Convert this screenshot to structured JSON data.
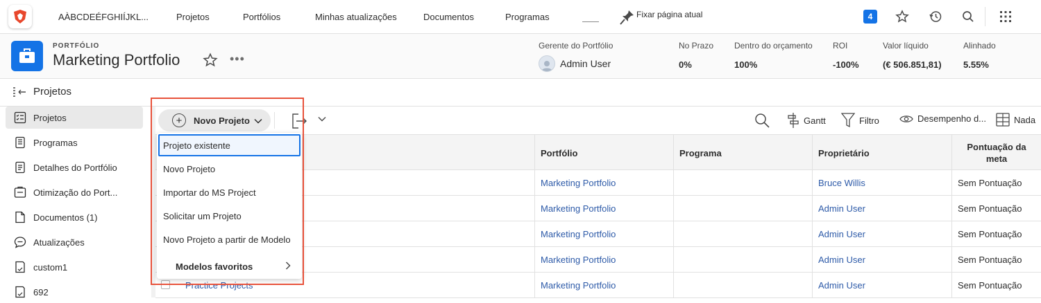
{
  "topnav": {
    "items": [
      "AÀBCDEÉFGHIÍJKL...",
      "Projetos",
      "Portfólios",
      "Minhas atualizações",
      "Documentos",
      "Programas"
    ],
    "pin_label": "Fixar página atual",
    "badge_count": "4",
    "icons": [
      "star-icon",
      "history-icon",
      "search-icon",
      "apps-grid-icon"
    ]
  },
  "portfolio": {
    "kicker": "PORTFÓLIO",
    "title": "Marketing Portfolio",
    "more": "•••",
    "manager_label": "Gerente do Portfólio",
    "manager_name": "Admin User",
    "metrics": [
      {
        "label": "No Prazo",
        "value": "0%"
      },
      {
        "label": "Dentro do orçamento",
        "value": "100%"
      },
      {
        "label": "ROI",
        "value": "-100%"
      },
      {
        "label": "Valor líquido",
        "value": "(€ 506.851,81)"
      },
      {
        "label": "Alinhado",
        "value": "5.55%"
      }
    ]
  },
  "left_panel": {
    "heading": "Projetos",
    "items": [
      "Projetos",
      "Programas",
      "Detalhes do Portfólio",
      "Otimização do Port...",
      "Documentos (1)",
      "Atualizações",
      "custom1",
      "692"
    ]
  },
  "toolbar": {
    "new_project": "Novo Projeto",
    "gantt": "Gantt",
    "filter": "Filtro",
    "view": "Desempenho d...",
    "grouping": "Nada"
  },
  "dropdown": {
    "items": [
      "Projeto existente",
      "Novo Projeto",
      "Importar do MS Project",
      "Solicitar um Projeto",
      "Novo Projeto a partir de Modelo"
    ],
    "favorites": "Modelos favoritos"
  },
  "table": {
    "headers": [
      "Portfólio",
      "Programa",
      "Proprietário",
      "Pontuação da meta"
    ],
    "rows": [
      {
        "name": "",
        "portfolio": "Marketing Portfolio",
        "program": "",
        "owner": "Bruce Willis",
        "score": "Sem Pontuação"
      },
      {
        "name": "",
        "portfolio": "Marketing Portfolio",
        "program": "",
        "owner": "Admin User",
        "score": "Sem Pontuação"
      },
      {
        "name": "",
        "portfolio": "Marketing Portfolio",
        "program": "",
        "owner": "Admin User",
        "score": "Sem Pontuação"
      },
      {
        "name": "",
        "portfolio": "Marketing Portfolio",
        "program": "",
        "owner": "Admin User",
        "score": "Sem Pontuação"
      },
      {
        "name": "Practice Projects",
        "portfolio": "Marketing Portfolio",
        "program": "",
        "owner": "Admin User",
        "score": "Sem Pontuação"
      }
    ]
  },
  "colors": {
    "accent": "#1473e6",
    "highlight": "#e8513a",
    "link": "#2d5aa8"
  }
}
